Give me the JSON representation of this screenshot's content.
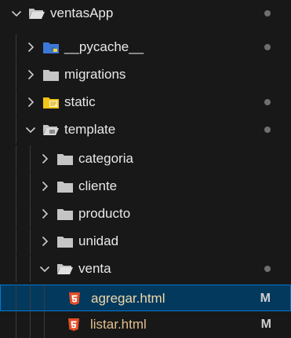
{
  "explorer": {
    "root": {
      "label": "ventasApp",
      "expanded": true,
      "status": "dot"
    },
    "items": [
      {
        "label": "__pycache__",
        "status": "dot"
      },
      {
        "label": "migrations",
        "status": ""
      },
      {
        "label": "static",
        "status": "dot"
      },
      {
        "label": "template",
        "status": "dot"
      },
      {
        "label": "categoria",
        "status": ""
      },
      {
        "label": "cliente",
        "status": ""
      },
      {
        "label": "producto",
        "status": ""
      },
      {
        "label": "unidad",
        "status": ""
      },
      {
        "label": "venta",
        "status": "dot"
      },
      {
        "label": "agregar.html",
        "status": "M",
        "selected": true
      },
      {
        "label": "listar.html",
        "status": "M"
      }
    ]
  },
  "colors": {
    "background": "#181818",
    "selection": "#04395e",
    "selection_border": "#0078d4",
    "modified_text": "#e2c08d",
    "html_icon": "#e44d26",
    "folder": "#c5c5c5",
    "python_folder": "#3c78d8",
    "static_folder": "#f5c518"
  }
}
